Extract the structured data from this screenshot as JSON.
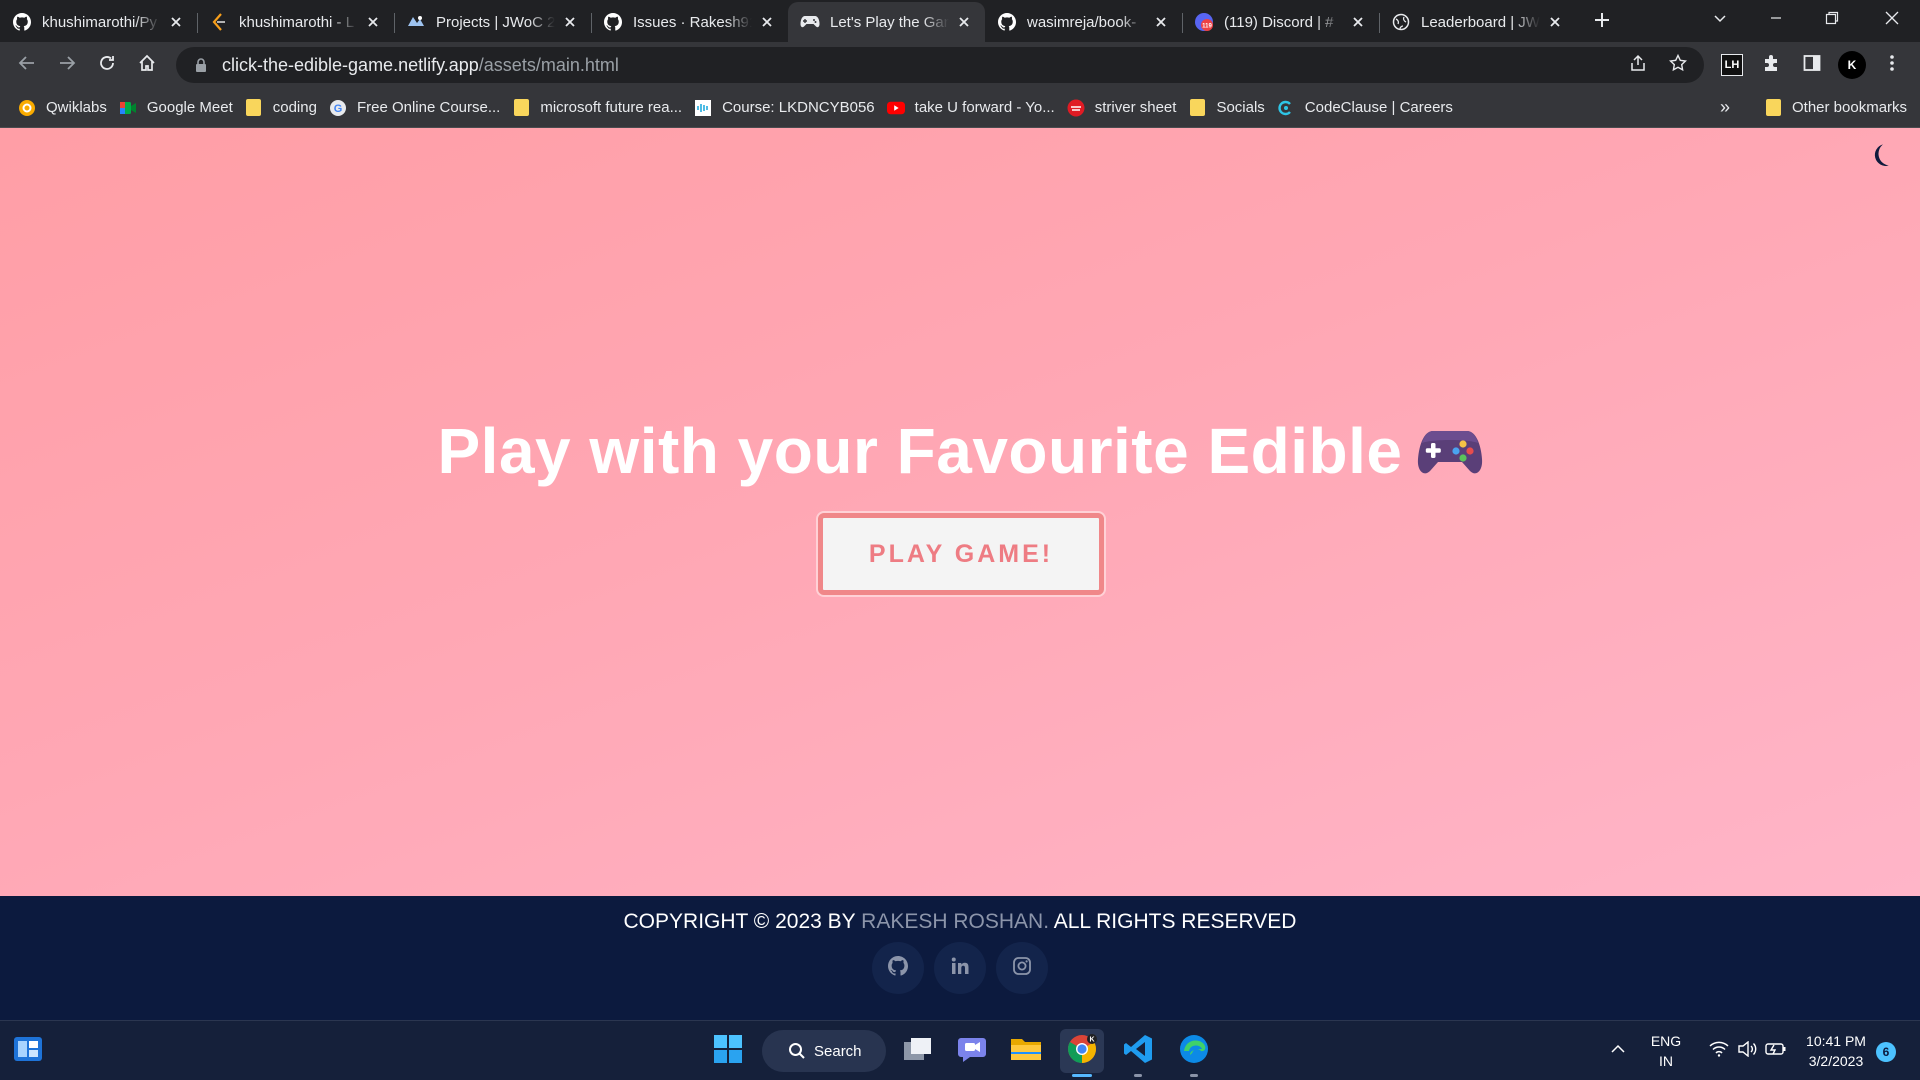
{
  "browser": {
    "tabs": [
      {
        "title": "khushimarothi/Py",
        "favicon": "github-icon"
      },
      {
        "title": "khushimarothi - L",
        "favicon": "leetcode-icon"
      },
      {
        "title": "Projects | JWoC 2",
        "favicon": "jwoc-icon"
      },
      {
        "title": "Issues · Rakesh91",
        "favicon": "github-icon"
      },
      {
        "title": "Let's Play the Gam",
        "favicon": "gamepad-icon"
      },
      {
        "title": "wasimreja/book-",
        "favicon": "github-icon"
      },
      {
        "title": "(119) Discord | #",
        "favicon": "discord-icon"
      },
      {
        "title": "Leaderboard | JW",
        "favicon": "globe-icon"
      }
    ],
    "active_tab_index": 4,
    "address": {
      "host": "click-the-edible-game.netlify.app",
      "path": "/assets/main.html"
    },
    "profile_initial": "K",
    "extension_label": "LH",
    "bookmarks": [
      {
        "label": "Qwiklabs",
        "icon": "qwiklabs-icon"
      },
      {
        "label": "Google Meet",
        "icon": "google-meet-icon"
      },
      {
        "label": "coding",
        "icon": "folder-icon"
      },
      {
        "label": "Free Online Course...",
        "icon": "google-icon"
      },
      {
        "label": "microsoft future rea...",
        "icon": "folder-icon"
      },
      {
        "label": "Course: LKDNCYB056",
        "icon": "cisco-icon"
      },
      {
        "label": "take U forward - Yo...",
        "icon": "youtube-icon"
      },
      {
        "label": "striver sheet",
        "icon": "tuf-icon"
      },
      {
        "label": "Socials",
        "icon": "folder-icon"
      },
      {
        "label": "CodeClause | Careers",
        "icon": "codeclause-icon"
      }
    ],
    "more_bookmarks": "»",
    "other_bookmarks": "Other bookmarks"
  },
  "page": {
    "headline": "Play with your Favourite Edible",
    "play_button": "PLAY GAME!",
    "footer": {
      "copyright_prefix": "COPYRIGHT © 2023 BY",
      "author": "RAKESH ROSHAN.",
      "copyright_suffix": "ALL RIGHTS RESERVED",
      "socials": [
        "github-icon",
        "linkedin-icon",
        "instagram-icon"
      ]
    }
  },
  "taskbar": {
    "search_label": "Search",
    "language": "ENG",
    "region": "IN",
    "time": "10:41 PM",
    "date": "3/2/2023",
    "notification_count": "6"
  },
  "colors": {
    "page_bg_start": "#ff9ea6",
    "page_bg_end": "#ffb5c8",
    "button_text": "#ee7c83",
    "button_border": "#f08789",
    "footer_bg": "#0c1a3e",
    "author": "#8c95aa",
    "taskbar_bg": "#15203a"
  }
}
